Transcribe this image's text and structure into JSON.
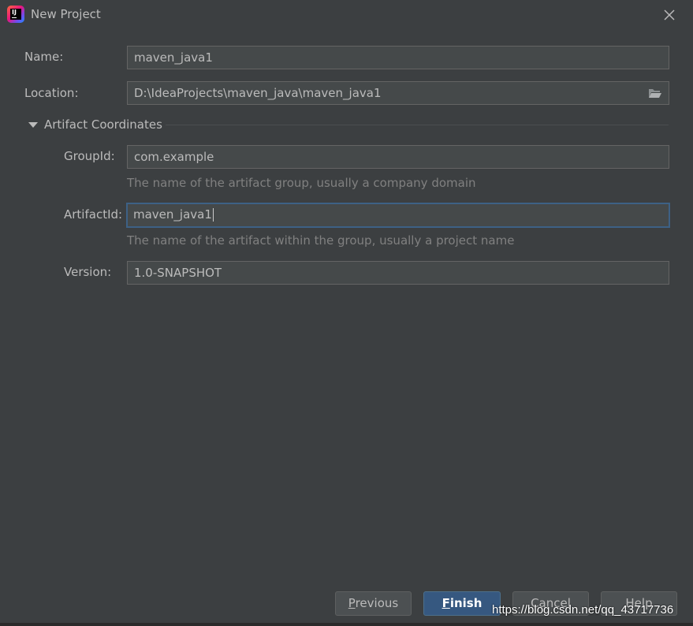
{
  "window": {
    "title": "New Project",
    "app_icon": "intellij-idea-icon",
    "close_icon": "close-icon"
  },
  "form": {
    "name": {
      "label": "Name:",
      "value": "maven_java1"
    },
    "location": {
      "label": "Location:",
      "value": "D:\\IdeaProjects\\maven_java\\maven_java1",
      "browse_icon": "folder-icon"
    },
    "artifact_section": {
      "label": "Artifact Coordinates",
      "expanded": true
    },
    "group_id": {
      "label": "GroupId:",
      "value": "com.example",
      "hint": "The name of the artifact group, usually a company domain"
    },
    "artifact_id": {
      "label": "ArtifactId:",
      "value": "maven_java1",
      "hint": "The name of the artifact within the group, usually a project name",
      "focused": true
    },
    "version": {
      "label": "Version:",
      "value": "1.0-SNAPSHOT"
    }
  },
  "buttons": {
    "previous": {
      "mnemonic": "P",
      "rest": "revious"
    },
    "finish": {
      "mnemonic": "F",
      "rest": "inish"
    },
    "cancel": {
      "label": "Cancel"
    },
    "help": {
      "label": "Help"
    }
  },
  "watermark": "https://blog.csdn.net/qq_43717736",
  "colors": {
    "background": "#3c3f41",
    "field": "#45494a",
    "focus_border": "#3d6185",
    "primary_button": "#365880",
    "hint_text": "#808080"
  }
}
